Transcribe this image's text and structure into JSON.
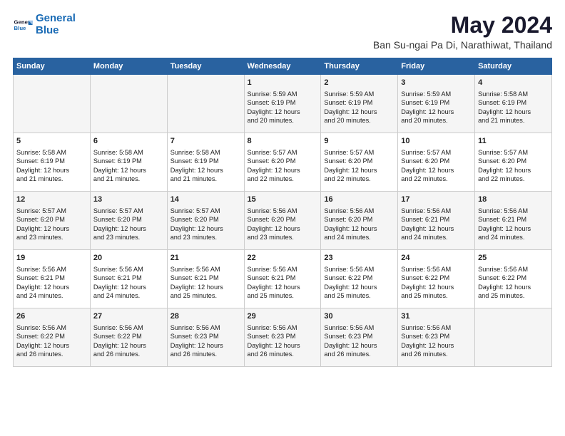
{
  "logo": {
    "text_general": "General",
    "text_blue": "Blue"
  },
  "header": {
    "title": "May 2024",
    "subtitle": "Ban Su-ngai Pa Di, Narathiwat, Thailand"
  },
  "days_of_week": [
    "Sunday",
    "Monday",
    "Tuesday",
    "Wednesday",
    "Thursday",
    "Friday",
    "Saturday"
  ],
  "weeks": [
    [
      {
        "day": "",
        "info": ""
      },
      {
        "day": "",
        "info": ""
      },
      {
        "day": "",
        "info": ""
      },
      {
        "day": "1",
        "info": "Sunrise: 5:59 AM\nSunset: 6:19 PM\nDaylight: 12 hours\nand 20 minutes."
      },
      {
        "day": "2",
        "info": "Sunrise: 5:59 AM\nSunset: 6:19 PM\nDaylight: 12 hours\nand 20 minutes."
      },
      {
        "day": "3",
        "info": "Sunrise: 5:59 AM\nSunset: 6:19 PM\nDaylight: 12 hours\nand 20 minutes."
      },
      {
        "day": "4",
        "info": "Sunrise: 5:58 AM\nSunset: 6:19 PM\nDaylight: 12 hours\nand 21 minutes."
      }
    ],
    [
      {
        "day": "5",
        "info": "Sunrise: 5:58 AM\nSunset: 6:19 PM\nDaylight: 12 hours\nand 21 minutes."
      },
      {
        "day": "6",
        "info": "Sunrise: 5:58 AM\nSunset: 6:19 PM\nDaylight: 12 hours\nand 21 minutes."
      },
      {
        "day": "7",
        "info": "Sunrise: 5:58 AM\nSunset: 6:19 PM\nDaylight: 12 hours\nand 21 minutes."
      },
      {
        "day": "8",
        "info": "Sunrise: 5:57 AM\nSunset: 6:20 PM\nDaylight: 12 hours\nand 22 minutes."
      },
      {
        "day": "9",
        "info": "Sunrise: 5:57 AM\nSunset: 6:20 PM\nDaylight: 12 hours\nand 22 minutes."
      },
      {
        "day": "10",
        "info": "Sunrise: 5:57 AM\nSunset: 6:20 PM\nDaylight: 12 hours\nand 22 minutes."
      },
      {
        "day": "11",
        "info": "Sunrise: 5:57 AM\nSunset: 6:20 PM\nDaylight: 12 hours\nand 22 minutes."
      }
    ],
    [
      {
        "day": "12",
        "info": "Sunrise: 5:57 AM\nSunset: 6:20 PM\nDaylight: 12 hours\nand 23 minutes."
      },
      {
        "day": "13",
        "info": "Sunrise: 5:57 AM\nSunset: 6:20 PM\nDaylight: 12 hours\nand 23 minutes."
      },
      {
        "day": "14",
        "info": "Sunrise: 5:57 AM\nSunset: 6:20 PM\nDaylight: 12 hours\nand 23 minutes."
      },
      {
        "day": "15",
        "info": "Sunrise: 5:56 AM\nSunset: 6:20 PM\nDaylight: 12 hours\nand 23 minutes."
      },
      {
        "day": "16",
        "info": "Sunrise: 5:56 AM\nSunset: 6:20 PM\nDaylight: 12 hours\nand 24 minutes."
      },
      {
        "day": "17",
        "info": "Sunrise: 5:56 AM\nSunset: 6:21 PM\nDaylight: 12 hours\nand 24 minutes."
      },
      {
        "day": "18",
        "info": "Sunrise: 5:56 AM\nSunset: 6:21 PM\nDaylight: 12 hours\nand 24 minutes."
      }
    ],
    [
      {
        "day": "19",
        "info": "Sunrise: 5:56 AM\nSunset: 6:21 PM\nDaylight: 12 hours\nand 24 minutes."
      },
      {
        "day": "20",
        "info": "Sunrise: 5:56 AM\nSunset: 6:21 PM\nDaylight: 12 hours\nand 24 minutes."
      },
      {
        "day": "21",
        "info": "Sunrise: 5:56 AM\nSunset: 6:21 PM\nDaylight: 12 hours\nand 25 minutes."
      },
      {
        "day": "22",
        "info": "Sunrise: 5:56 AM\nSunset: 6:21 PM\nDaylight: 12 hours\nand 25 minutes."
      },
      {
        "day": "23",
        "info": "Sunrise: 5:56 AM\nSunset: 6:22 PM\nDaylight: 12 hours\nand 25 minutes."
      },
      {
        "day": "24",
        "info": "Sunrise: 5:56 AM\nSunset: 6:22 PM\nDaylight: 12 hours\nand 25 minutes."
      },
      {
        "day": "25",
        "info": "Sunrise: 5:56 AM\nSunset: 6:22 PM\nDaylight: 12 hours\nand 25 minutes."
      }
    ],
    [
      {
        "day": "26",
        "info": "Sunrise: 5:56 AM\nSunset: 6:22 PM\nDaylight: 12 hours\nand 26 minutes."
      },
      {
        "day": "27",
        "info": "Sunrise: 5:56 AM\nSunset: 6:22 PM\nDaylight: 12 hours\nand 26 minutes."
      },
      {
        "day": "28",
        "info": "Sunrise: 5:56 AM\nSunset: 6:23 PM\nDaylight: 12 hours\nand 26 minutes."
      },
      {
        "day": "29",
        "info": "Sunrise: 5:56 AM\nSunset: 6:23 PM\nDaylight: 12 hours\nand 26 minutes."
      },
      {
        "day": "30",
        "info": "Sunrise: 5:56 AM\nSunset: 6:23 PM\nDaylight: 12 hours\nand 26 minutes."
      },
      {
        "day": "31",
        "info": "Sunrise: 5:56 AM\nSunset: 6:23 PM\nDaylight: 12 hours\nand 26 minutes."
      },
      {
        "day": "",
        "info": ""
      }
    ]
  ]
}
